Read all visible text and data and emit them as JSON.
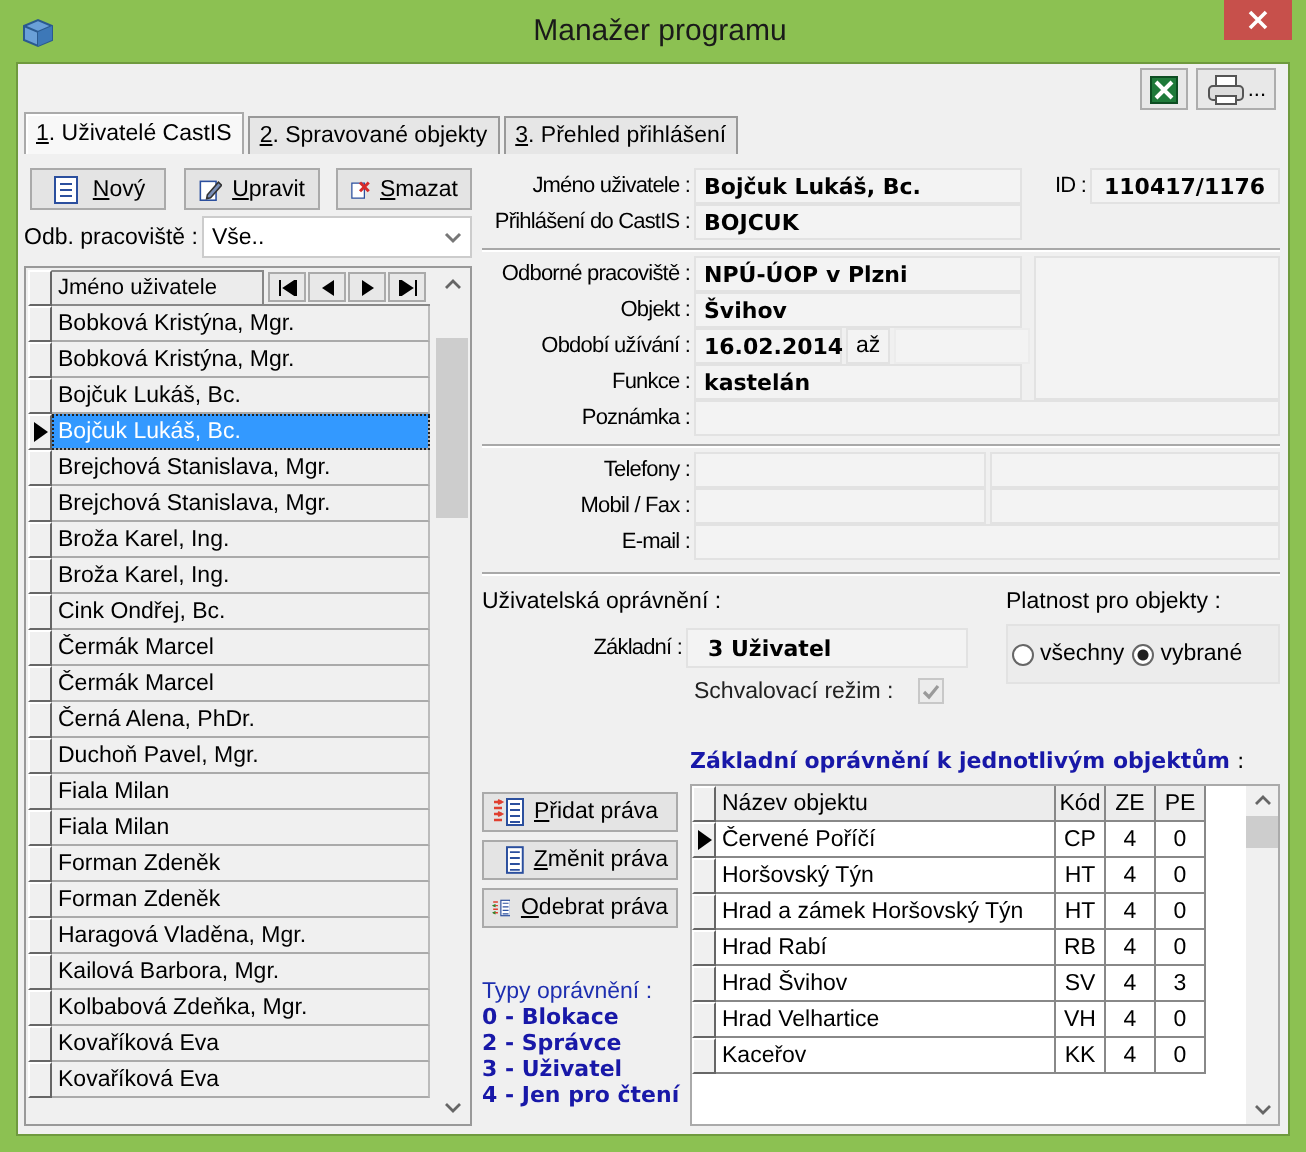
{
  "window": {
    "title": "Manažer programu"
  },
  "toolbar": {
    "print_suffix": "..."
  },
  "tabs": [
    {
      "label": "1. Uživatelé CastIS",
      "selected": true
    },
    {
      "label": "2. Spravované objekty",
      "selected": false
    },
    {
      "label": "3. Přehled přihlášení",
      "selected": false
    }
  ],
  "user_buttons": [
    {
      "label": "Nový",
      "kind": "new"
    },
    {
      "label": "Upravit",
      "kind": "edit"
    },
    {
      "label": "Smazat",
      "kind": "delete"
    }
  ],
  "filter": {
    "label": "Odb. pracoviště :",
    "value": "Vše.."
  },
  "users_grid": {
    "column": "Jméno uživatele",
    "rows": [
      {
        "name": "Bobková Kristýna, Mgr.",
        "selected": false
      },
      {
        "name": "Bobková Kristýna, Mgr.",
        "selected": false
      },
      {
        "name": "Bojčuk Lukáš, Bc.",
        "selected": false
      },
      {
        "name": "Bojčuk Lukáš, Bc.",
        "selected": true
      },
      {
        "name": "Brejchová Stanislava, Mgr.",
        "selected": false
      },
      {
        "name": "Brejchová Stanislava, Mgr.",
        "selected": false
      },
      {
        "name": "Broža Karel, Ing.",
        "selected": false
      },
      {
        "name": "Broža Karel, Ing.",
        "selected": false
      },
      {
        "name": "Cink Ondřej, Bc.",
        "selected": false
      },
      {
        "name": "Čermák Marcel",
        "selected": false
      },
      {
        "name": "Čermák Marcel",
        "selected": false
      },
      {
        "name": "Černá Alena, PhDr.",
        "selected": false
      },
      {
        "name": "Duchoň Pavel, Mgr.",
        "selected": false
      },
      {
        "name": "Fiala Milan",
        "selected": false
      },
      {
        "name": "Fiala Milan",
        "selected": false
      },
      {
        "name": "Forman Zdeněk",
        "selected": false
      },
      {
        "name": "Forman Zdeněk",
        "selected": false
      },
      {
        "name": "Haragová Vladěna, Mgr.",
        "selected": false
      },
      {
        "name": "Kailová Barbora, Mgr.",
        "selected": false
      },
      {
        "name": "Kolbabová Zdeňka, Mgr.",
        "selected": false
      },
      {
        "name": "Kovaříková Eva",
        "selected": false
      },
      {
        "name": "Kovaříková Eva",
        "selected": false
      }
    ]
  },
  "user": {
    "name_label": "Jméno uživatele :",
    "name": "Bojčuk Lukáš, Bc.",
    "id_label": "ID :",
    "id": "110417/1176",
    "login_label": "Přihlášení do CastIS :",
    "login": "BOJCUK"
  },
  "assignment": {
    "workplace_label": "Odborné pracoviště :",
    "workplace": "NPÚ-ÚOP v Plzni",
    "object_label": "Objekt :",
    "object": "Švihov",
    "period_label": "Období užívání :",
    "period_from": "16.02.2014",
    "period_to_label": "až",
    "function_label": "Funkce :",
    "function": "kastelán",
    "note_label": "Poznámka :"
  },
  "contact": [
    {
      "label": "Telefony :",
      "kind": "double"
    },
    {
      "label": "Mobil / Fax :",
      "kind": "double"
    },
    {
      "label": "E-mail :",
      "kind": "single"
    }
  ],
  "permissions": {
    "label": "Uživatelská oprávnění :",
    "basic_label": "Základní :",
    "basic": "3 Uživatel",
    "approval_label": "Schvalovací režim :",
    "approval_checked": true,
    "validity_label": "Platnost pro objekty :",
    "validity": [
      {
        "label": "všechny",
        "selected": false
      },
      {
        "label": "vybrané",
        "selected": true
      }
    ]
  },
  "rights_buttons": [
    {
      "label": "Přidat práva",
      "kind": "add"
    },
    {
      "label": "Změnit práva",
      "kind": "change"
    },
    {
      "label": "Odebrat práva",
      "kind": "remove"
    }
  ],
  "legend": {
    "title": "Typy oprávnění :",
    "items": [
      "0 - Blokace",
      "2 - Správce",
      "3 - Uživatel",
      "4 - Jen pro čtení"
    ]
  },
  "object_rights": {
    "title": "Základní oprávnění k jednotlivým objektům",
    "title_suffix": ":",
    "columns": [
      "Název objektu",
      "Kód",
      "ZE",
      "PE"
    ],
    "rows": [
      {
        "cells": [
          "Červené Poříčí",
          "CP",
          "4",
          "0"
        ],
        "selected": true
      },
      {
        "cells": [
          "Horšovský Týn",
          "HT",
          "4",
          "0"
        ],
        "selected": false
      },
      {
        "cells": [
          "Hrad a zámek Horšovský Týn",
          "HT",
          "4",
          "0"
        ],
        "selected": false
      },
      {
        "cells": [
          "Hrad Rabí",
          "RB",
          "4",
          "0"
        ],
        "selected": false
      },
      {
        "cells": [
          "Hrad Švihov",
          "SV",
          "4",
          "3"
        ],
        "selected": false
      },
      {
        "cells": [
          "Hrad Velhartice",
          "VH",
          "4",
          "0"
        ],
        "selected": false
      },
      {
        "cells": [
          "Kaceřov",
          "KK",
          "4",
          "0"
        ],
        "selected": false
      }
    ]
  }
}
